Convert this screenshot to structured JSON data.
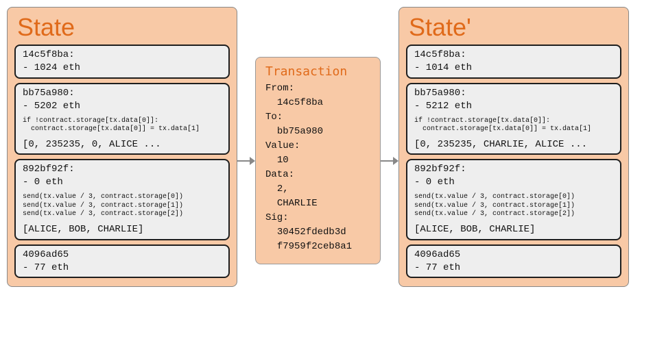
{
  "state_before": {
    "title": "State",
    "accounts": [
      {
        "addr": "14c5f8ba:",
        "balance": "- 1024 eth",
        "code": "",
        "storage": ""
      },
      {
        "addr": "bb75a980:",
        "balance": "- 5202 eth",
        "code": "if !contract.storage[tx.data[0]]:\n  contract.storage[tx.data[0]] = tx.data[1]",
        "storage": "[0, 235235, 0, ALICE ..."
      },
      {
        "addr": "892bf92f:",
        "balance": "- 0 eth",
        "code": "send(tx.value / 3, contract.storage[0])\nsend(tx.value / 3, contract.storage[1])\nsend(tx.value / 3, contract.storage[2])",
        "storage": "[ALICE, BOB, CHARLIE]"
      },
      {
        "addr": "4096ad65",
        "balance": "- 77 eth",
        "code": "",
        "storage": ""
      }
    ]
  },
  "transaction": {
    "title": "Transaction",
    "fields": {
      "from_label": "From:",
      "from": "14c5f8ba",
      "to_label": "To:",
      "to": "bb75a980",
      "value_label": "Value:",
      "value": "10",
      "data_label": "Data:",
      "data1": "2,",
      "data2": "CHARLIE",
      "sig_label": "Sig:",
      "sig1": "30452fdedb3d",
      "sig2": "f7959f2ceb8a1"
    }
  },
  "state_after": {
    "title": "State'",
    "accounts": [
      {
        "addr": "14c5f8ba:",
        "balance": "- 1014 eth",
        "code": "",
        "storage": ""
      },
      {
        "addr": "bb75a980:",
        "balance": "- 5212 eth",
        "code": "if !contract.storage[tx.data[0]]:\n  contract.storage[tx.data[0]] = tx.data[1]",
        "storage": "[0, 235235, CHARLIE, ALICE ..."
      },
      {
        "addr": "892bf92f:",
        "balance": "- 0 eth",
        "code": "send(tx.value / 3, contract.storage[0])\nsend(tx.value / 3, contract.storage[1])\nsend(tx.value / 3, contract.storage[2])",
        "storage": "[ALICE, BOB, CHARLIE]"
      },
      {
        "addr": "4096ad65",
        "balance": "- 77 eth",
        "code": "",
        "storage": ""
      }
    ]
  }
}
